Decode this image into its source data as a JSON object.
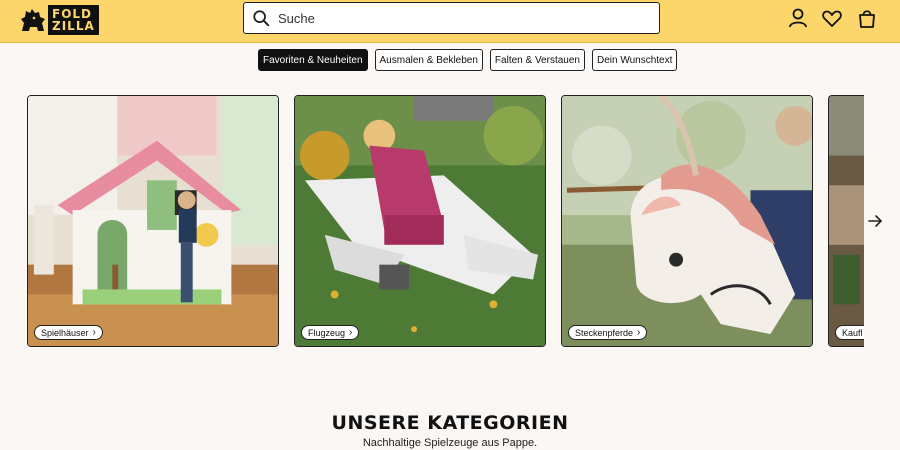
{
  "header": {
    "logo": {
      "line1": "FOLD",
      "line2": "ZILLA"
    },
    "search": {
      "placeholder": "Suche",
      "value": ""
    },
    "icons": [
      "search-icon",
      "account-icon",
      "heart-icon",
      "bag-icon"
    ]
  },
  "filters": [
    {
      "label": "Favoriten & Neuheiten",
      "active": true
    },
    {
      "label": "Ausmalen & Bekleben",
      "active": false
    },
    {
      "label": "Falten & Verstauen",
      "active": false
    },
    {
      "label": "Dein Wunschtext",
      "active": false
    }
  ],
  "cards": [
    {
      "label": "Spielhäuser"
    },
    {
      "label": "Flugzeug"
    },
    {
      "label": "Steckenpferde"
    },
    {
      "label": "Kaufl"
    }
  ],
  "carousel": {
    "next_icon": "arrow-right-icon"
  },
  "section": {
    "title": "UNSERE KATEGORIEN",
    "subtitle": "Nachhaltige Spielzeuge aus Pappe."
  },
  "colors": {
    "header_bg": "#fcd66a",
    "page_bg": "#faf7f4",
    "active_pill": "#111111"
  }
}
